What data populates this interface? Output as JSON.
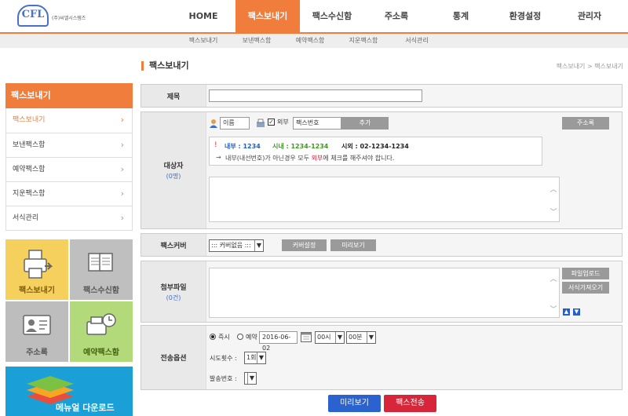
{
  "header": {
    "logo_mark": "CFL",
    "company": "(주)씨엘시스템즈",
    "nav": [
      "HOME",
      "팩스보내기",
      "팩스수신함",
      "주소록",
      "통계",
      "환경설정",
      "관리자"
    ]
  },
  "subnav": [
    "팩스보내기",
    "보낸팩스함",
    "예약팩스함",
    "지운팩스함",
    "서식관리"
  ],
  "sidebar": {
    "title": "팩스보내기",
    "items": [
      "팩스보내기",
      "보낸팩스함",
      "예약팩스함",
      "지운팩스함",
      "서식관리"
    ],
    "chevron": "›",
    "tiles": [
      "팩스보내기",
      "팩스수신함",
      "주소록",
      "예약팩스함"
    ],
    "manual": "메뉴얼 다운로드"
  },
  "main": {
    "title": "팩스보내기",
    "breadcrumb": "팩스보내기 > 팩스보내기",
    "subject": {
      "label": "제목",
      "value": ""
    },
    "recipients": {
      "label": "대상자",
      "count": "(0명)",
      "name_placeholder": "이름",
      "external_label": "외부",
      "fax_placeholder": "팩스번호",
      "add_btn": "추가",
      "address_btn": "주소록",
      "info_internal": "내부 : 1234",
      "info_local": "시내 : 1234-1234",
      "info_long": "시외 : 02-1234-1234",
      "note_prefix": "내부(내선번호)가 아닌경우 모두 ",
      "note_highlight": "외부",
      "note_suffix": "에 체크를 해주셔야 합니다.",
      "arrow": "→"
    },
    "cover": {
      "label": "팩스커버",
      "select": "::: 커버없음 :::",
      "setting_btn": "커버설정",
      "preview_btn": "미리보기"
    },
    "attach": {
      "label": "첨부파일",
      "count": "(0건)",
      "upload_btn": "파일업로드",
      "template_btn": "서식가져오기"
    },
    "options": {
      "label": "전송옵션",
      "immediate": "즉시",
      "reserve": "예약",
      "date": "2016-06-02",
      "hour": "00시",
      "minute": "00분",
      "retry_label": "시도횟수 :",
      "retry_value": "1회",
      "sender_label": "발송번호 :",
      "sender_value": ""
    },
    "preview_btn": "미리보기",
    "send_btn": "팩스전송"
  },
  "colors": {
    "accent": "#f07d3c",
    "blue": "#1f5fd1",
    "red": "#d7263a"
  }
}
